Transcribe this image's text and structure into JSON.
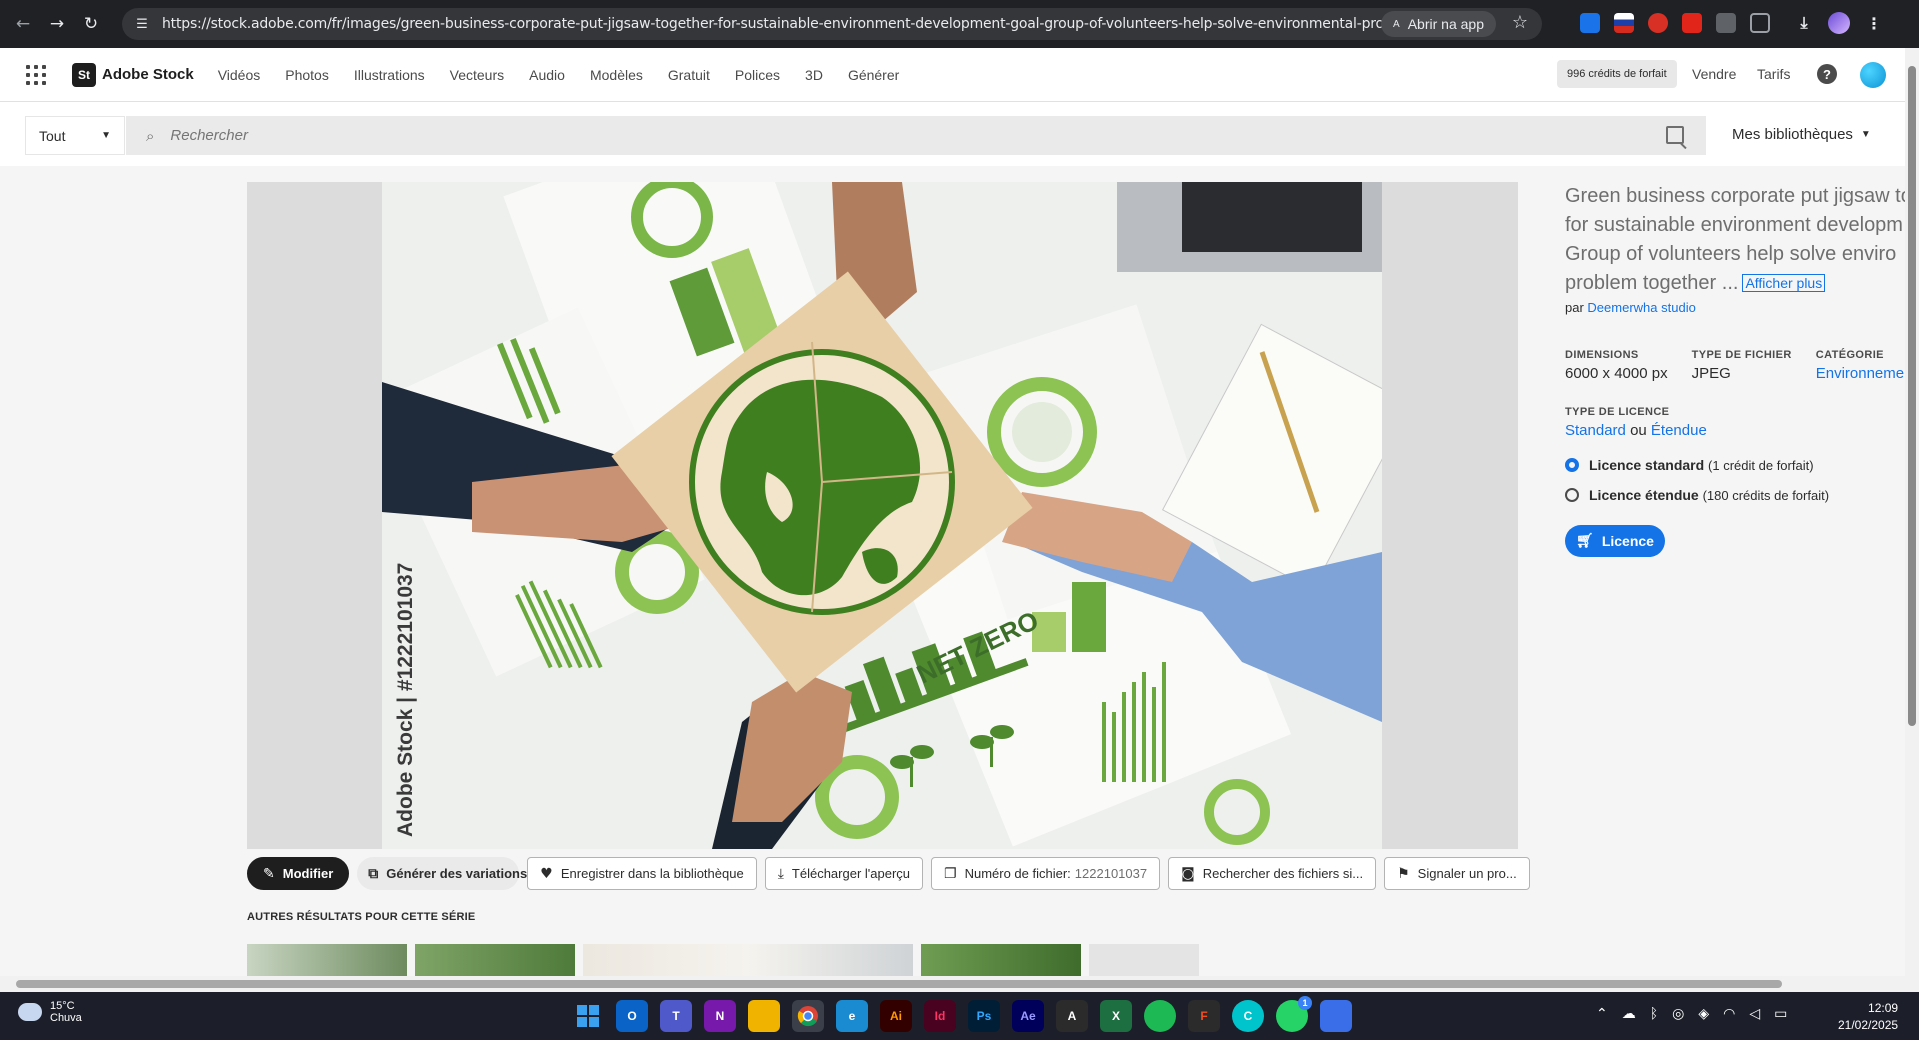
{
  "browser": {
    "url": "https://stock.adobe.com/fr/images/green-business-corporate-put-jigsaw-together-for-sustainable-environment-development-goal-group-of-volunteers-help-solve-environmental-problem-together-...",
    "open_app_label": "Abrir na app"
  },
  "header": {
    "logo_badge": "St",
    "logo_text": "Adobe Stock",
    "nav": [
      "Vidéos",
      "Photos",
      "Illustrations",
      "Vecteurs",
      "Audio",
      "Modèles",
      "Gratuit",
      "Polices",
      "3D",
      "Générer"
    ],
    "credits": "996 crédits de forfait",
    "sell": "Vendre",
    "pricing": "Tarifs",
    "help": "?"
  },
  "search": {
    "scope": "Tout",
    "placeholder": "Rechercher",
    "libraries": "Mes bibliothèques"
  },
  "photo": {
    "watermark": "Adobe Stock | #1222101037",
    "overlay_text": "NET ZERO"
  },
  "actions": {
    "edit": "Modifier",
    "variations": "Générer des variations",
    "save": "Enregistrer dans la bibliothèque",
    "download": "Télécharger l'aperçu",
    "file_number_label": "Numéro de fichier:",
    "file_number": "1222101037",
    "find_similar": "Rechercher des fichiers si...",
    "report": "Signaler un pro..."
  },
  "series": {
    "title": "AUTRES RÉSULTATS POUR CETTE SÉRIE"
  },
  "info": {
    "title_lines": [
      "Green business corporate put jigsaw to",
      "for sustainable environment developm",
      "Group of volunteers help solve enviro",
      "problem together ..."
    ],
    "show_more": "Afficher plus",
    "by_prefix": "par",
    "author": "Deemerwha studio",
    "dimensions_label": "DIMENSIONS",
    "dimensions": "6000 x 4000 px",
    "filetype_label": "TYPE DE FICHIER",
    "filetype": "JPEG",
    "category_label": "CATÉGORIE",
    "category": "Environnemen",
    "license_type_label": "TYPE DE LICENCE",
    "license_standard": "Standard",
    "license_or": "ou",
    "license_extended": "Étendue",
    "option_standard": "Licence standard",
    "option_standard_cost": "(1 crédit de forfait)",
    "option_extended": "Licence étendue",
    "option_extended_cost": "(180 crédits de forfait)",
    "license_button": "Licence"
  },
  "taskbar": {
    "temp": "15°C",
    "weather": "Chuva",
    "time": "12:09",
    "date": "21/02/2025",
    "badge": "1"
  },
  "colors": {
    "accent": "#1473e6",
    "dark_button": "#1e1e1e",
    "browser_bg": "#202124",
    "taskbar_bg": "#1c1f2a"
  }
}
